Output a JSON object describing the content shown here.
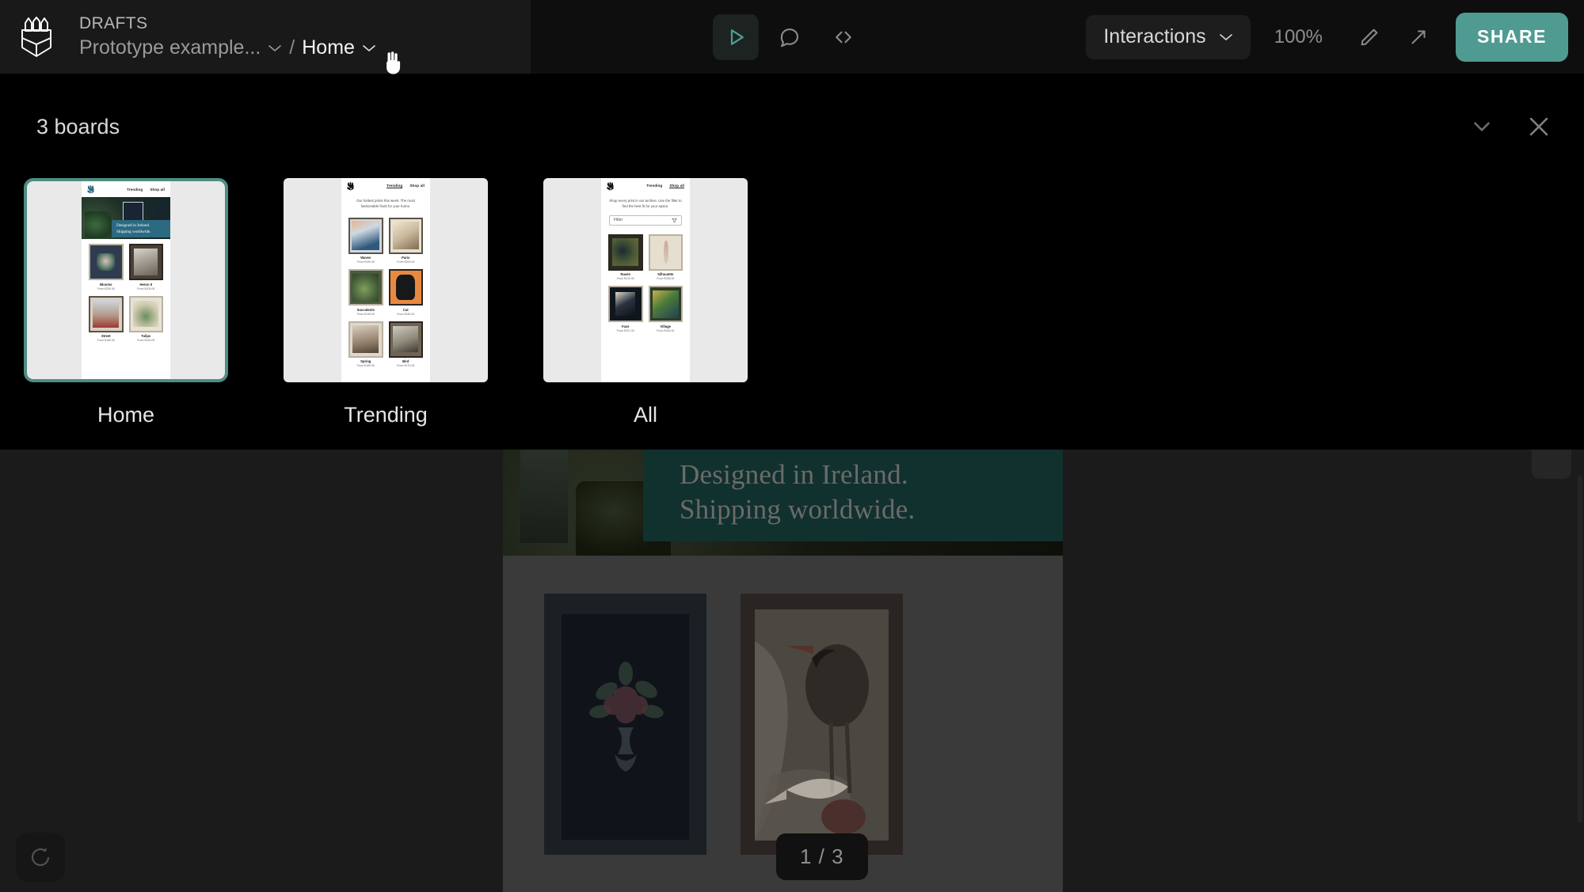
{
  "app": {
    "logo_icon": "pencils-box-logo",
    "workspace_label": "DRAFTS",
    "project_name": "Prototype example...",
    "separator": "/",
    "current_board": "Home"
  },
  "toolbar": {
    "play_icon": "play-icon",
    "comment_icon": "comment-icon",
    "code_icon": "code-icon",
    "interactions_label": "Interactions",
    "zoom_level": "100%",
    "pencil_icon": "pencil-icon",
    "fullscreen_icon": "expand-arrow-icon",
    "share_label": "SHARE",
    "accent_color": "#4f9b92"
  },
  "boards_panel": {
    "count_label": "3 boards",
    "collapse_icon": "chevron-down-icon",
    "close_icon": "close-icon",
    "selected_index": 0,
    "boards": [
      {
        "label": "Home",
        "selected": true,
        "screen": {
          "nav": {
            "trending": "Trending",
            "shop_all": "Shop all",
            "active": "none"
          },
          "hero": {
            "line1": "Designed in Ireland.",
            "line2": "Shipping worldwide.",
            "banner_color": "#2b6a80"
          },
          "description": "",
          "filter_label": "",
          "products": [
            {
              "name": "Blooms",
              "price": "From €200.00",
              "art": "aw-blooms",
              "frame": "mini-frame-border-light"
            },
            {
              "name": "Heron II",
              "price": "From €200.00",
              "art": "aw-heron",
              "frame": "mini-frame-border-dark"
            },
            {
              "name": "Street",
              "price": "From €180.00",
              "art": "aw-street",
              "frame": "mini-frame-border"
            },
            {
              "name": "Tulips",
              "price": "From €150.00",
              "art": "aw-tulips",
              "frame": "mini-frame-border-light"
            }
          ]
        }
      },
      {
        "label": "Trending",
        "selected": false,
        "screen": {
          "nav": {
            "trending": "Trending",
            "shop_all": "Shop all",
            "active": "trending"
          },
          "hero": null,
          "description": "Our hottest prints this week. The most fashionable finds for your home.",
          "filter_label": "",
          "products": [
            {
              "name": "Waves",
              "price": "From €190.00",
              "art": "aw-waves",
              "frame": "mini-frame-border"
            },
            {
              "name": "Paris",
              "price": "From €200.00",
              "art": "aw-paris",
              "frame": "mini-frame-border"
            },
            {
              "name": "Succulents",
              "price": "From €195.00",
              "art": "aw-succ",
              "frame": "mini-frame-border-light"
            },
            {
              "name": "Cat",
              "price": "From €180.00",
              "art": "aw-cat",
              "frame": "mini-frame-border-dark"
            },
            {
              "name": "Spring",
              "price": "From €160.00",
              "art": "aw-spring",
              "frame": "mini-frame-border-light"
            },
            {
              "name": "Bird",
              "price": "From €170.00",
              "art": "aw-bird",
              "frame": "mini-frame-border-dark"
            }
          ]
        }
      },
      {
        "label": "All",
        "selected": false,
        "screen": {
          "nav": {
            "trending": "Trending",
            "shop_all": "Shop all",
            "active": "shop_all"
          },
          "hero": null,
          "description": "Shop every print in our archive. Use the filter to find the best fit for your space.",
          "filter_label": "Filter",
          "filter_icon": "filter-funnel-icon",
          "products": [
            {
              "name": "Raven",
              "price": "From €210.00",
              "art": "aw-raven",
              "frame": "mini-frame-border-dark"
            },
            {
              "name": "Silhouette",
              "price": "From €185.00",
              "art": "aw-silh",
              "frame": "mini-frame-border-light"
            },
            {
              "name": "Face",
              "price": "From €221.00",
              "art": "aw-face",
              "frame": "mini-frame-border-light"
            },
            {
              "name": "Village",
              "price": "From €183.00",
              "art": "aw-village",
              "frame": "mini-frame-border-light"
            }
          ]
        }
      }
    ]
  },
  "canvas": {
    "hero_line1": "Designed in Ireland.",
    "hero_line2": "Shipping worldwide.",
    "page_indicator": "1 / 3",
    "restart_icon": "restart-icon",
    "banner_color": "#11312f"
  }
}
